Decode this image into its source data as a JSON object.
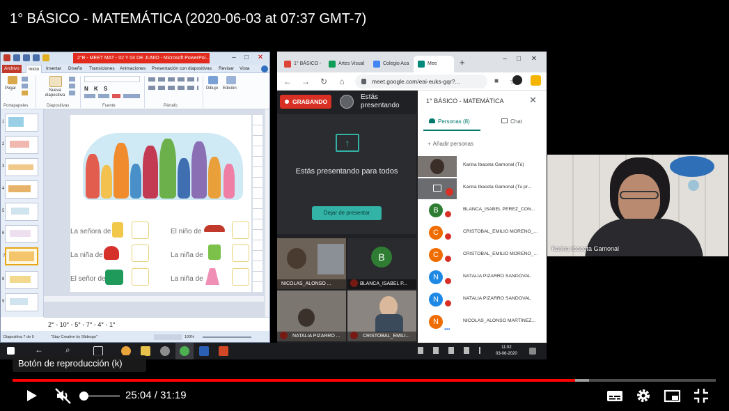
{
  "video": {
    "title": "1° BÁSICO - MATEMÁTICA (2020-06-03 at 07:37 GMT-7)",
    "tooltip": "Botón de reproducción (k)",
    "current_time": "25:04",
    "time_separator": "/",
    "duration": "31:19",
    "played_fraction": 0.8,
    "buffered_fraction": 0.82,
    "icons": [
      "play-icon",
      "muted-volume-icon",
      "subtitles-icon",
      "settings-gear-icon",
      "miniplayer-icon",
      "fullscreen-icon"
    ]
  },
  "ppt": {
    "window_title": "2°B - MEET MAT - 02 Y 04 DE JUNIO - Microsoft PowerPoi...",
    "tabs": [
      "Archivo",
      "Inicio",
      "Insertar",
      "Diseño",
      "Transiciones",
      "Animaciones",
      "Presentación con diapositivas",
      "Revisar",
      "Vista"
    ],
    "ribbon": {
      "paste": "Pegar",
      "new_slide": "Nueva diapositiva",
      "drawing": "Dibujo",
      "editing": "Edición",
      "groups": [
        "Portapapeles",
        "Diapositivas",
        "Fuente",
        "Párrafo"
      ]
    },
    "slide_numbers": [
      "1",
      "2",
      "3",
      "4",
      "5",
      "6",
      "7",
      "8",
      "9"
    ],
    "selected_slide": 7,
    "slide_labels": {
      "l1": "La señora de",
      "l2": "La niña de",
      "l3": "El señor de",
      "r1": "El niño de",
      "r2": "La niña de",
      "r3": "La niña de"
    },
    "notes": "2° - 10° - 5° - 7° - 4° - 1°",
    "status": {
      "slide_info": "Diapositiva 7 de 9",
      "theme": "\"Stay Creative by Slidesgo\"",
      "zoom": "100%"
    }
  },
  "chrome": {
    "tabs": [
      {
        "label": "1° BÁSICO -",
        "color": "#db4437"
      },
      {
        "label": "Artes Visual",
        "color": "#0f9d58"
      },
      {
        "label": "Colegio Aca",
        "color": "#4285f4"
      },
      {
        "label": "Mee",
        "color": "#00897b"
      }
    ],
    "new_tab": "+",
    "url": "meet.google.com/eai-euks-gqr?...",
    "meet": {
      "recording": "GRABANDO",
      "presenting_status": "Estás presentando",
      "presenting_main": "Estás presentando para todos",
      "stop_button": "Dejar de presentar",
      "tiles": [
        {
          "name": "NICOLAS_ALONSO ..."
        },
        {
          "name": "BLANCA_ISABEL P...",
          "initial": "B"
        },
        {
          "name": "NATALIA PIZARRO ..."
        },
        {
          "name": "CRISTOBAL_EMILI..."
        }
      ]
    },
    "people_panel": {
      "title": "1° BÁSICO - MATEMÁTICA",
      "people_tab": "Personas (8)",
      "chat_tab": "Chat",
      "add_people": "Añadir personas",
      "participants": [
        {
          "name": "Karina Ibaceta Gamonal (Tú)",
          "initial": ""
        },
        {
          "name": "Karina Ibaceta Gamonal (Tu pr...",
          "initial": ""
        },
        {
          "name": "BLANCA_ISABEL PEREZ_CON...",
          "initial": "B",
          "color": "#2e7d32"
        },
        {
          "name": "CRISTOBAL_EMILIO MORENO_...",
          "initial": "C",
          "color": "#ef6c00"
        },
        {
          "name": "CRISTOBAL_EMILIO MORENO_...",
          "initial": "C",
          "color": "#ef6c00"
        },
        {
          "name": "NATALIA PIZARRO SANDOVAL",
          "initial": "N",
          "color": "#1e88e5"
        },
        {
          "name": "NATALIA PIZARRO SANDOVAL",
          "initial": "N",
          "color": "#1e88e5"
        },
        {
          "name": "NICOLAS_ALONSO MARTINEZ...",
          "initial": "N",
          "color": "#ef6c00"
        }
      ]
    }
  },
  "taskbar": {
    "time": "11:02",
    "date": "03-06-2020"
  },
  "webcam": {
    "name": "Karina Ibaceta Gamonal"
  }
}
